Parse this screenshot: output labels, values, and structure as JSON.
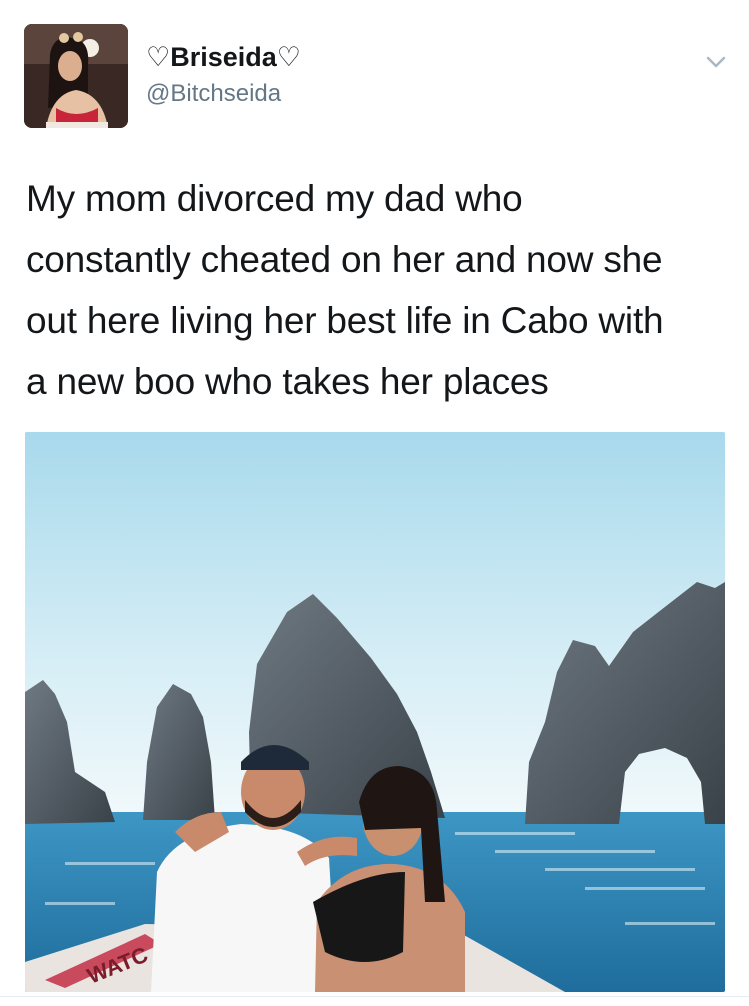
{
  "tweet": {
    "display_name": "♡Briseida♡",
    "handle": "@Bitchseida",
    "text": "My mom divorced my dad who\nconstantly cheated on her and now she\nout here living her best life in Cabo with\na new boo who takes her places",
    "more_icon": "chevron-down-icon",
    "photo": {
      "boat_text": "WATC"
    }
  },
  "colors": {
    "text_primary": "#14171a",
    "text_secondary": "#657786",
    "sky": "#bfe2ef",
    "sea": "#2f86b8",
    "rock": "#4e565e"
  }
}
